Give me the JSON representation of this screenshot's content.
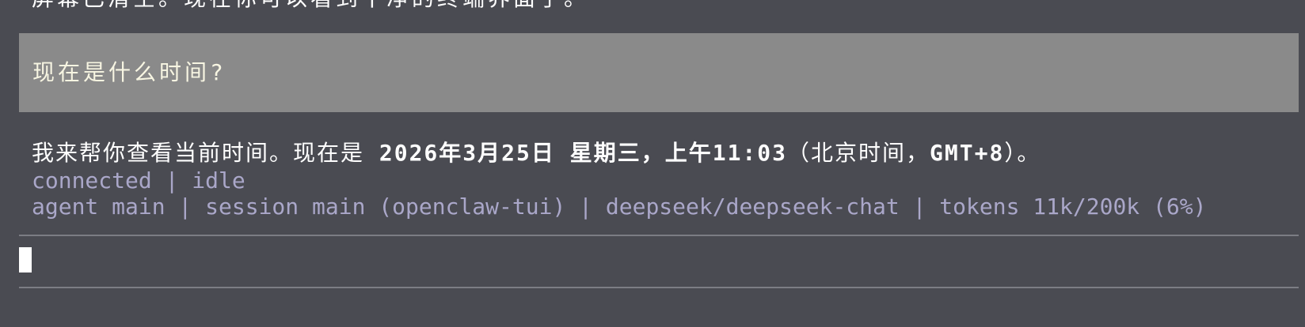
{
  "history": {
    "previous_partial": "屏幕已清空。现在你可以看到干净的终端界面了。"
  },
  "user_message": {
    "text": "现在是什么时间?"
  },
  "assistant_message": {
    "prefix": "我来帮你查看当前时间。现在是 ",
    "datetime": "2026年3月25日 星期三，上午11:03",
    "paren_open": "（北京时间，",
    "timezone": "GMT+8",
    "paren_close": "）。"
  },
  "status": {
    "connection": "connected | idle",
    "session": "agent main | session main (openclaw-tui) | deepseek/deepseek-chat | tokens 11k/200k (6%)"
  },
  "input": {
    "value": ""
  },
  "colors": {
    "background": "#4a4b52",
    "user_message_bg": "#8a8a8a",
    "user_message_text": "#f7f5e2",
    "status_text": "#aaa7c9",
    "separator": "#7c7d84",
    "cursor": "#ffffff"
  }
}
